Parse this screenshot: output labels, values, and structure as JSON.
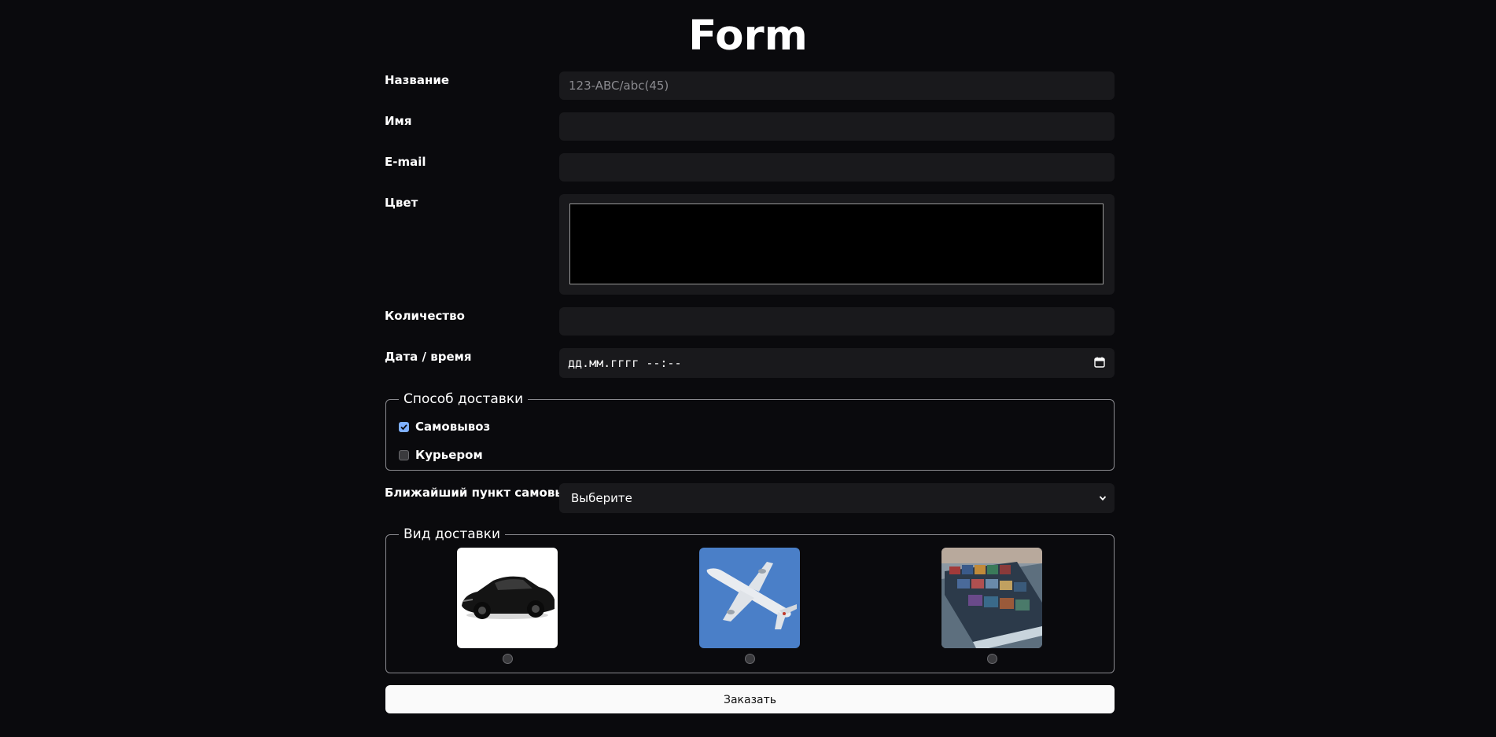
{
  "page": {
    "title": "Form"
  },
  "form": {
    "name": {
      "label": "Название",
      "placeholder": "123-ABC/abc(45)",
      "value": ""
    },
    "first_name": {
      "label": "Имя",
      "value": ""
    },
    "email": {
      "label": "E-mail",
      "value": ""
    },
    "color": {
      "label": "Цвет",
      "value": "#000000"
    },
    "quantity": {
      "label": "Количество",
      "value": ""
    },
    "datetime": {
      "label": "Дата / время",
      "placeholder": "дд.мм.гггг --:--",
      "icon": "calendar-icon"
    }
  },
  "delivery_method": {
    "legend": "Способ доставки",
    "options": [
      {
        "label": "Самовывоз",
        "checked": true
      },
      {
        "label": "Курьером",
        "checked": false
      }
    ]
  },
  "pickup_point": {
    "label": "Ближайший пункт самовывоза",
    "selected": "Выберите",
    "icon": "chevron-down-icon"
  },
  "delivery_type": {
    "legend": "Вид доставки",
    "options": [
      {
        "name": "car",
        "image": "car-image",
        "selected": false
      },
      {
        "name": "airplane",
        "image": "airplane-image",
        "selected": false
      },
      {
        "name": "ship",
        "image": "ship-image",
        "selected": false
      }
    ]
  },
  "submit": {
    "label": "Заказать"
  },
  "colors": {
    "background": "#0a0a0d",
    "field": "#19191c",
    "accent": "#7fb0ff",
    "button": "#fafafa"
  }
}
